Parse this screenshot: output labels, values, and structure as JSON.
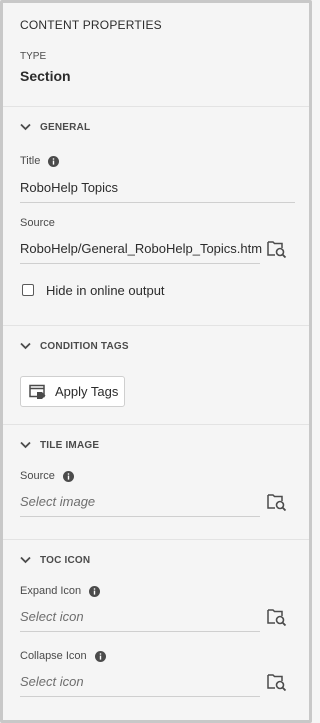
{
  "panel": {
    "title": "CONTENT PROPERTIES",
    "type_label": "TYPE",
    "type_value": "Section"
  },
  "general": {
    "heading": "GENERAL",
    "title_label": "Title",
    "title_value": "RoboHelp Topics",
    "source_label": "Source",
    "source_value": "RoboHelp/General_RoboHelp_Topics.htm",
    "hide_label": "Hide in online output",
    "hide_checked": false
  },
  "condition_tags": {
    "heading": "CONDITION TAGS",
    "apply_label": "Apply Tags"
  },
  "tile_image": {
    "heading": "TILE IMAGE",
    "source_label": "Source",
    "source_placeholder": "Select image"
  },
  "toc_icon": {
    "heading": "TOC ICON",
    "expand_label": "Expand Icon",
    "expand_placeholder": "Select icon",
    "collapse_label": "Collapse Icon",
    "collapse_placeholder": "Select icon"
  },
  "icons": {
    "chevron": "chevron-down-icon",
    "info": "info-icon",
    "browse": "browse-folder-icon",
    "tag": "apply-tags-icon"
  },
  "colors": {
    "background": "#f5f5f5",
    "text": "#2c2c2c",
    "muted": "#4b4b4b",
    "placeholder": "#6e6e6e",
    "divider": "#e3e3e3"
  }
}
